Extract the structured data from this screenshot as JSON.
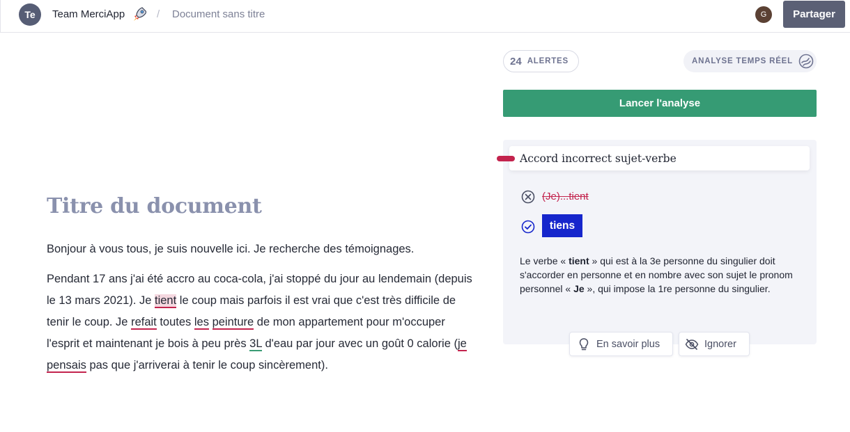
{
  "header": {
    "team_initials": "Te",
    "team_name": "Team MerciApp",
    "team_icon": "rocket-icon",
    "separator": "/",
    "document_title": "Document sans titre",
    "user_initial": "G",
    "share_label": "Partager"
  },
  "editor": {
    "heading": "Titre du document",
    "paragraph1": "Bonjour à vous tous, je suis nouvelle ici. Je recherche des témoignages.",
    "p2": {
      "s1": "Pendant 17 ans j'ai été accro au coca-cola, j'ai stoppé du jour au lendemain (depuis le 13 mars 2021). Je ",
      "e1": "tient",
      "s2": " le coup mais parfois il est vrai que c'est très difficile de tenir le coup. Je ",
      "e2": "refait",
      "s3": " toutes ",
      "e3": "les",
      "s4": " ",
      "e4": "peinture",
      "s5": " de mon appartement pour m'occuper l'esprit et maintenant je bois à peu près ",
      "e5": "3L",
      "s6": " d'eau par jour avec un goût 0 calorie (",
      "e6": "je pensais",
      "s7": " pas que j'arriverai à tenir le coup sincèrement)."
    }
  },
  "panel": {
    "alerts_count": "24",
    "alerts_label": "ALERTES",
    "realtime_label": "ANALYSE TEMPS RÉEL",
    "analyze_label": "Lancer l'analyse",
    "card": {
      "title": "Accord incorrect sujet-verbe",
      "wrong": "(Je)...tient",
      "suggestion": "tiens",
      "exp": {
        "t1": "Le verbe « ",
        "b1": "tient",
        "t2": " » qui est à la 3e personne du singulier doit s'accorder en personne et en nombre avec son sujet le pronom personnel « ",
        "b2": "Je",
        "t3": " », qui impose la 1re personne du singulier."
      },
      "learn_more_label": "En savoir plus",
      "ignore_label": "Ignorer"
    }
  },
  "colors": {
    "accent_green": "#369b74",
    "error_red": "#c3234d",
    "suggestion_blue": "#1626cc",
    "heading_gray": "#8a91ad"
  }
}
